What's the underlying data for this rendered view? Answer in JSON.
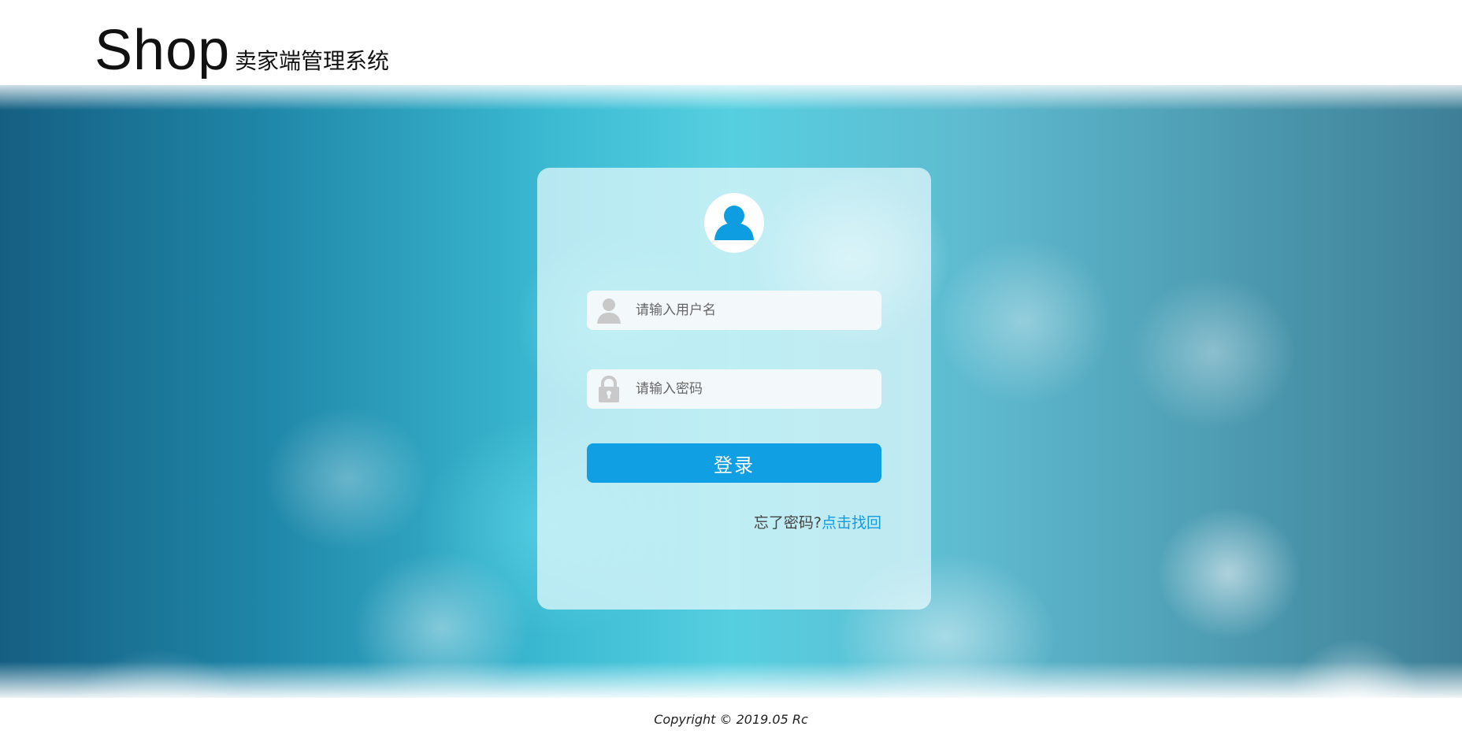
{
  "header": {
    "brand": "Shop",
    "subtitle": "卖家端管理系统"
  },
  "login": {
    "avatar_icon": "user-avatar-icon",
    "username_icon": "user-icon",
    "password_icon": "lock-icon",
    "username_placeholder": "请输入用户名",
    "password_placeholder": "请输入密码",
    "submit_label": "登录",
    "forgot_prefix": "忘了密码?",
    "forgot_link": "点击找回"
  },
  "footer": {
    "copyright": "Copyright © 2019.05 Rc"
  },
  "colors": {
    "accent": "#119fe3",
    "link": "#139bdf"
  }
}
